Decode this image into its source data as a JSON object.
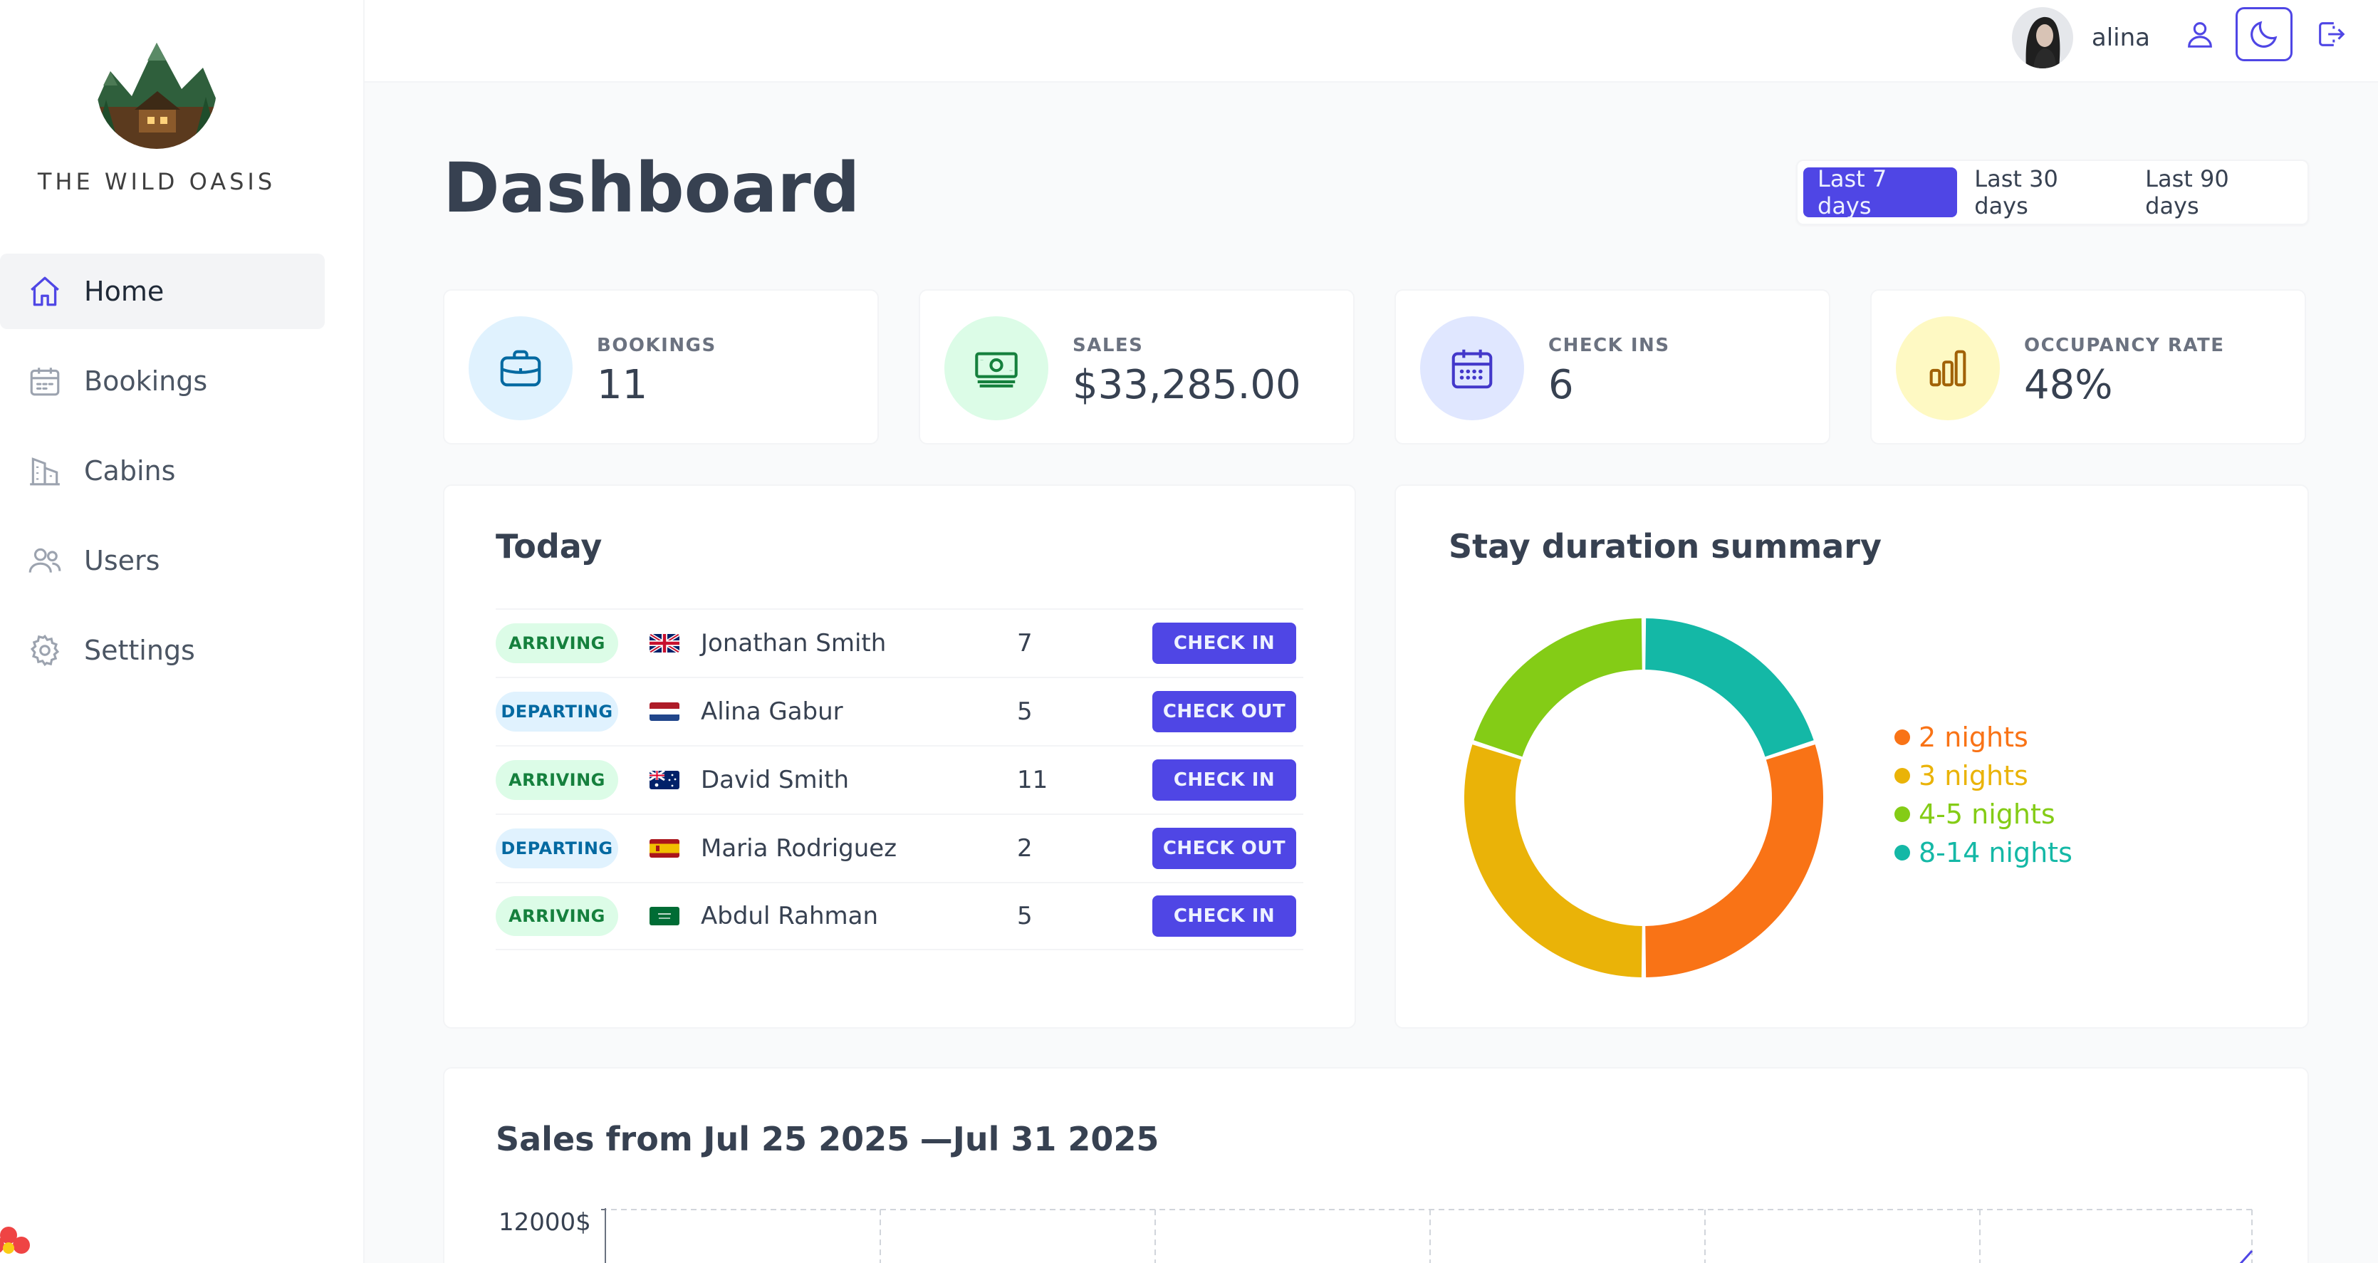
{
  "brand": {
    "name": "THE WILD OASIS"
  },
  "sidebar": {
    "items": [
      {
        "label": "Home",
        "icon": "home-icon",
        "active": true
      },
      {
        "label": "Bookings",
        "icon": "calendar-icon",
        "active": false
      },
      {
        "label": "Cabins",
        "icon": "building-icon",
        "active": false
      },
      {
        "label": "Users",
        "icon": "users-icon",
        "active": false
      },
      {
        "label": "Settings",
        "icon": "gear-icon",
        "active": false
      }
    ]
  },
  "header": {
    "user_name": "alina",
    "icons": [
      "user-icon",
      "moon-icon",
      "logout-icon"
    ]
  },
  "page": {
    "title": "Dashboard"
  },
  "filter": {
    "options": [
      "Last 7 days",
      "Last 30 days",
      "Last 90 days"
    ],
    "selected": "Last 7 days"
  },
  "stats": [
    {
      "title": "BOOKINGS",
      "value": "11",
      "icon": "briefcase-icon",
      "color": "#0369a1",
      "bg": "#e0f2fe"
    },
    {
      "title": "SALES",
      "value": "$33,285.00",
      "icon": "banknotes-icon",
      "color": "#15803d",
      "bg": "#dcfce7"
    },
    {
      "title": "CHECK INS",
      "value": "6",
      "icon": "calendar-days-icon",
      "color": "#4338ca",
      "bg": "#e0e7ff"
    },
    {
      "title": "OCCUPANCY RATE",
      "value": "48%",
      "icon": "chart-bar-icon",
      "color": "#a16207",
      "bg": "#fef9c3"
    }
  ],
  "today": {
    "title": "Today",
    "rows": [
      {
        "status": "ARRIVING",
        "flag": "gb-flag-icon",
        "guest": "Jonathan Smith",
        "nights": "7",
        "action": "CHECK IN"
      },
      {
        "status": "DEPARTING",
        "flag": "nl-flag-icon",
        "guest": "Alina Gabur",
        "nights": "5",
        "action": "CHECK OUT"
      },
      {
        "status": "ARRIVING",
        "flag": "au-flag-icon",
        "guest": "David Smith",
        "nights": "11",
        "action": "CHECK IN"
      },
      {
        "status": "DEPARTING",
        "flag": "es-flag-icon",
        "guest": "Maria Rodriguez",
        "nights": "2",
        "action": "CHECK OUT"
      },
      {
        "status": "ARRIVING",
        "flag": "sa-flag-icon",
        "guest": "Abdul Rahman",
        "nights": "5",
        "action": "CHECK IN"
      }
    ]
  },
  "stay_duration": {
    "title": "Stay duration summary"
  },
  "chart_data": {
    "type": "pie",
    "title": "Stay duration summary",
    "categories": [
      "2 nights",
      "3 nights",
      "4-5 nights",
      "8-14 nights"
    ],
    "values": [
      3,
      3,
      2,
      2
    ],
    "colors": [
      "#f97316",
      "#eab308",
      "#84cc16",
      "#14b8a6"
    ],
    "donut": true,
    "legend_placement": "right"
  },
  "sales": {
    "title_prefix": "Sales from",
    "date_from": "Jul 25 2025",
    "separator": "—",
    "date_to": "Jul 31 2025",
    "y_tick_top": "12000$"
  }
}
